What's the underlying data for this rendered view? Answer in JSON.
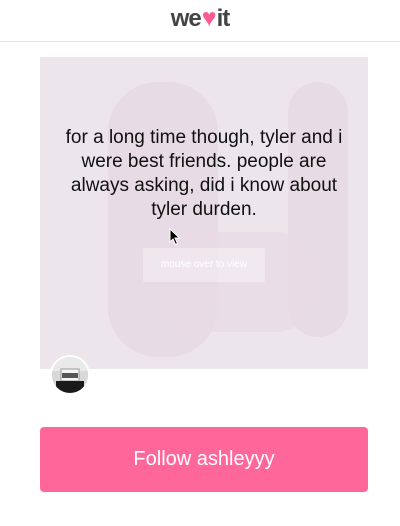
{
  "header": {
    "logo_pre": "we",
    "logo_heart": "♥",
    "logo_post": "it"
  },
  "post": {
    "quote": "for a long time though, tyler and i were best friends. people are always asking, did i know about tyler durden.",
    "overlay_label": "mouse over to view"
  },
  "follow": {
    "label": "Follow ashleyyy"
  },
  "colors": {
    "brand_pink": "#ff6699",
    "card_bg": "#ece5ec"
  }
}
